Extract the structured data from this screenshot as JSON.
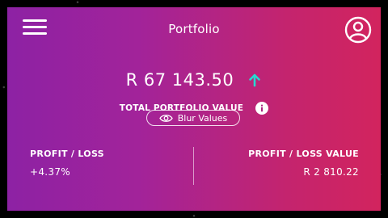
{
  "header": {
    "title": "Portfolio",
    "menu_icon": "hamburger-menu-icon",
    "user_icon": "user-account-icon"
  },
  "portfolio": {
    "total_value": "R 67 143.50",
    "trend_icon": "arrow-up-icon",
    "trend_color": "#27d9d0",
    "total_label": "TOTAL PORTFOLIO VALUE",
    "info_icon": "info-icon",
    "blur_button_label": "Blur Values",
    "blur_icon": "eye-icon"
  },
  "stats": {
    "profit_loss_label": "PROFIT / LOSS",
    "profit_loss_value": "+4.37%",
    "profit_loss_value_label": "PROFIT / LOSS VALUE",
    "profit_loss_value_amount": "R 2 810.22"
  },
  "colors": {
    "gradient_start": "#8d22a4",
    "gradient_end": "#d2245e",
    "text": "#ffffff"
  }
}
